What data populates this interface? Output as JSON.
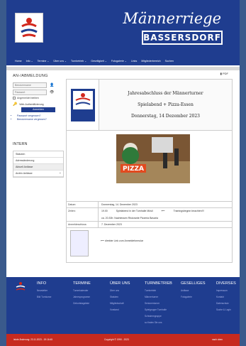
{
  "header": {
    "title": "Männerriege",
    "subtitle": "BASSERSDORF",
    "nav": [
      "Home",
      "Info ⌄",
      "Termine ⌄",
      "Über uns ⌄",
      "Turnbetrieb ⌄",
      "Geselligkeit ⌄",
      "Fotogalerie ⌄",
      "Links",
      "Mitgliederbereich",
      "Suchen"
    ]
  },
  "sidebar": {
    "login_title": "AN-/ABMELDUNG",
    "username_placeholder": "Benutzername",
    "password_placeholder": "Passwort",
    "remember_label": "Angemeldet bleiben",
    "webauth_label": "Web-Authentifizierung",
    "login_button": "Anmelden",
    "links": [
      "Passwort vergessen?",
      "Benutzername vergessen?"
    ],
    "intern_title": "INTERN",
    "menu": [
      "Statuten",
      "Adressänderung",
      "Aktuell Anlässe",
      "Archiv Anlässe"
    ]
  },
  "pdf_label": "PDF",
  "event": {
    "title": "Jahresabschluss der Männerturner",
    "subtitle": "Spielabend + Pizza-Essen",
    "date_line": "Donnerstag, 14 Dezember 2023",
    "datum_label": "Datum:",
    "datum_value": "Donnerstag, 14. Dezember 2023",
    "zeiten_label": "Zeiten:",
    "time1": "19.00",
    "time1_text": "Spielabend in der Turnhalle Mösli",
    "time1_note": "Trainingsbeginn beachten!!!",
    "time2": "ca. 20.30h: Nachtessen Ristorante Pizzeria Bavaria",
    "anmelde_label": "Anmeldeschluss:",
    "anmelde_value": "7. Dezember 2023",
    "link_text": "direkter Link zum Anmeldeformular"
  },
  "footer": {
    "columns": [
      {
        "title": "INFO",
        "items": [
          "Newsletter",
          "Bild Turnkurse"
        ]
      },
      {
        "title": "TERMINE",
        "items": [
          "Turnerkalender",
          "Jahresprogramm",
          "Geburtstagsliste"
        ]
      },
      {
        "title": "ÜBER UNS",
        "items": [
          "Über uns",
          "Statuten",
          "Mitgliedschaft",
          "Vorstand"
        ]
      },
      {
        "title": "TURNBETRIEB",
        "items": [
          "Turnbetrieb",
          "Männerturner",
          "Seniorenturner",
          "Spielgruppe Turnhalle",
          "Schwimmgruppe",
          "so finden Sie uns"
        ]
      },
      {
        "title": "GESELLIGES",
        "items": [
          "Anlässe",
          "Fotogalerie"
        ]
      },
      {
        "title": "DIVERSES",
        "items": [
          "Impressum",
          "Kontakt",
          "Datenschutz",
          "Suche & Login"
        ]
      }
    ],
    "last_change": "letzte Änderung: 23.11.2023 - 19:16:45",
    "copyright": "Copyright © 1990 - 2023",
    "top": "nach oben"
  },
  "colors": {
    "brand": "#1f3d8f",
    "accent": "#c62a1f"
  }
}
